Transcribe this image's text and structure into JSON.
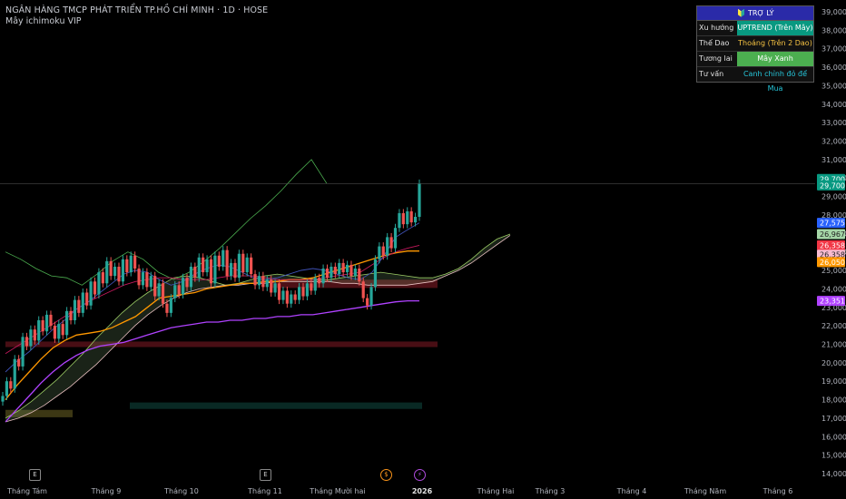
{
  "header": {
    "title": "NGÂN HÀNG TMCP PHÁT TRIỂN TP.HỒ CHÍ MINH · 1D · HOSE",
    "indicator": "Mây ichimoku VIP"
  },
  "assistant": {
    "title": "🔰 TRỢ LÝ",
    "rows": [
      {
        "label": "Xu hướng",
        "value": "UPTREND (Trên Mây)",
        "bg": "#089981",
        "fg": "#ffffff"
      },
      {
        "label": "Thế Dao",
        "value": "Thoáng (Trên 2 Dao)",
        "bg": "#111111",
        "fg": "#f5c242"
      },
      {
        "label": "Tương lai",
        "value": "Mây Xanh",
        "bg": "#4caf50",
        "fg": "#ffffff"
      },
      {
        "label": "Tư vấn",
        "value": "Canh chỉnh đỏ để Mua",
        "bg": "#111111",
        "fg": "#26c6da"
      }
    ]
  },
  "x_axis": {
    "labels": [
      {
        "text": "Tháng Tám",
        "bold": false
      },
      {
        "text": "Tháng 9",
        "bold": false
      },
      {
        "text": "Tháng 10",
        "bold": false
      },
      {
        "text": "Tháng 11",
        "bold": false
      },
      {
        "text": "Tháng Mười hai",
        "bold": false
      },
      {
        "text": "2026",
        "bold": true
      },
      {
        "text": "Tháng Hai",
        "bold": false
      },
      {
        "text": "Tháng 3",
        "bold": false
      },
      {
        "text": "Tháng 4",
        "bold": false
      },
      {
        "text": "Tháng Năm",
        "bold": false
      },
      {
        "text": "Tháng 6",
        "bold": false
      }
    ]
  },
  "events": [
    {
      "symbol": "E",
      "kind": "earnings"
    },
    {
      "symbol": "E",
      "kind": "earnings"
    },
    {
      "symbol": "$",
      "kind": "dividend",
      "color": "#f7931a"
    },
    {
      "symbol": "⚡",
      "kind": "split",
      "color": "#b04ce0"
    }
  ],
  "chart_data": {
    "type": "candlestick",
    "y_axis": {
      "min": 14000,
      "max": 39000,
      "ticks": [
        14000,
        15000,
        16000,
        17000,
        18000,
        19000,
        20000,
        21000,
        22000,
        23000,
        24000,
        25000,
        26000,
        27000,
        28000,
        29000,
        30000,
        31000,
        32000,
        33000,
        34000,
        35000,
        36000,
        37000,
        38000,
        39000
      ]
    },
    "tick_labels": [
      "14,000",
      "15,000",
      "16,000",
      "17,000",
      "18,000",
      "19,000",
      "20,000",
      "21,000",
      "22,000",
      "23,000",
      "24,000",
      "25,000",
      "26,000",
      "27,000",
      "28,000",
      "29,000",
      "30,000",
      "31,000",
      "32,000",
      "33,000",
      "34,000",
      "35,000",
      "36,000",
      "37,000",
      "38,000",
      "39,000"
    ],
    "last_price": 29700,
    "price_badges": [
      {
        "text": "29,700",
        "value": 29950,
        "color": "#089981"
      },
      {
        "text": "29,700",
        "value": 29600,
        "color": "#089981"
      },
      {
        "text": "27,575",
        "value": 27575,
        "color": "#2962ff"
      },
      {
        "text": "26,967",
        "value": 26967,
        "color": "#a5d6a7"
      },
      {
        "text": "26,358",
        "value": 26358,
        "color": "#f23645"
      },
      {
        "text": "26,358",
        "value": 25850,
        "color": "#f8bbd0"
      },
      {
        "text": "26,050",
        "value": 25450,
        "color": "#ff9800"
      },
      {
        "text": "23,351",
        "value": 23351,
        "color": "#b042ff"
      }
    ],
    "candles_close": [
      18200,
      19000,
      18600,
      20200,
      19800,
      21400,
      20900,
      21800,
      21200,
      22300,
      21700,
      22600,
      22000,
      21300,
      22100,
      21500,
      22800,
      22300,
      23400,
      22700,
      23800,
      23100,
      24400,
      23700,
      24900,
      24300,
      25500,
      24700,
      25200,
      24400,
      25600,
      24900,
      25800,
      25100,
      24200,
      24900,
      24100,
      24700,
      23600,
      24300,
      23200,
      22700,
      23500,
      24200,
      23700,
      24600,
      24100,
      25200,
      24600,
      25700,
      24900,
      25600,
      24300,
      25800,
      25200,
      26100,
      24700,
      25400,
      24600,
      25900,
      24900,
      25700,
      24800,
      24200,
      24700,
      24100,
      24500,
      23800,
      24300,
      23400,
      23900,
      23200,
      23700,
      23400,
      24100,
      23600,
      24300,
      23900,
      24600,
      24300,
      25100,
      24600,
      25200,
      24800,
      25400,
      24900,
      25300,
      24700,
      25100,
      24400,
      23500,
      23100,
      24100,
      25600,
      26300,
      25800,
      26800,
      26200,
      27300,
      28100,
      27500,
      28200,
      27600,
      27900,
      29700
    ],
    "tenkan": [
      19500,
      20100,
      20600,
      21200,
      21800,
      22300,
      22900,
      23300,
      23800,
      24300,
      24800,
      25000,
      24900,
      24500,
      24200,
      24400,
      24800,
      25100,
      25300,
      25200,
      24900,
      24600,
      24500,
      24600,
      24800,
      25000,
      25100,
      25000,
      24800,
      24600,
      24500,
      24900,
      25800,
      26800,
      27200,
      27575
    ],
    "kijun": [
      20500,
      20900,
      21300,
      21700,
      22100,
      22500,
      22900,
      23300,
      23600,
      23900,
      24200,
      24400,
      24500,
      24600,
      24600,
      24500,
      24500,
      24500,
      24600,
      24700,
      24700,
      24700,
      24600,
      24500,
      24500,
      24500,
      24500,
      24600,
      24700,
      24800,
      24900,
      25300,
      25700,
      26000,
      26200,
      26358
    ],
    "baseline_orange": [
      18000,
      18800,
      19500,
      20200,
      20800,
      21200,
      21500,
      21600,
      21700,
      21900,
      22200,
      22500,
      23000,
      23500,
      23600,
      23700,
      23800,
      24000,
      24100,
      24200,
      24300,
      24300,
      24400,
      24400,
      24500,
      24500,
      24600,
      24800,
      25000,
      25200,
      25400,
      25600,
      25800,
      25950,
      26050,
      26050
    ],
    "baseline_purple": [
      16800,
      17500,
      18200,
      18900,
      19500,
      20000,
      20400,
      20700,
      20900,
      21000,
      21100,
      21300,
      21500,
      21700,
      21900,
      22000,
      22100,
      22200,
      22200,
      22300,
      22300,
      22400,
      22400,
      22500,
      22500,
      22600,
      22600,
      22700,
      22800,
      22900,
      23000,
      23100,
      23200,
      23300,
      23351,
      23351
    ],
    "cloud_span_a": [
      17000,
      17400,
      17900,
      18500,
      19100,
      19800,
      20500,
      21300,
      22000,
      22700,
      23300,
      23800,
      24200,
      24600,
      24700,
      24600,
      24400,
      24200,
      24300,
      24500,
      24700,
      24800,
      24700,
      24600,
      24500,
      24500,
      24600,
      24700,
      24800,
      24900,
      24800,
      24700,
      24600,
      24600,
      24800,
      25100,
      25600,
      26200,
      26700,
      26967
    ],
    "cloud_span_b": [
      16800,
      17000,
      17300,
      17700,
      18200,
      18700,
      19300,
      19900,
      20600,
      21300,
      22000,
      22600,
      23100,
      23500,
      23800,
      24000,
      24100,
      24200,
      24200,
      24300,
      24300,
      24400,
      24400,
      24400,
      24400,
      24400,
      24300,
      24300,
      24200,
      24200,
      24200,
      24200,
      24300,
      24400,
      24700,
      25000,
      25400,
      25900,
      26400,
      26900
    ],
    "chikou": [
      26000,
      25600,
      25100,
      24700,
      24600,
      24200,
      24800,
      25500,
      26000,
      25600,
      24900,
      24500,
      24900,
      25500,
      26200,
      27000,
      27800,
      28500,
      29300,
      30200,
      31000,
      29700
    ],
    "zones": [
      {
        "type": "resistance",
        "from": 20850,
        "to": 21150
      },
      {
        "type": "resistance",
        "from": 24050,
        "to": 24500
      },
      {
        "type": "support",
        "from": 17500,
        "to": 17850
      },
      {
        "type": "support",
        "from": 17050,
        "to": 17450
      }
    ]
  }
}
